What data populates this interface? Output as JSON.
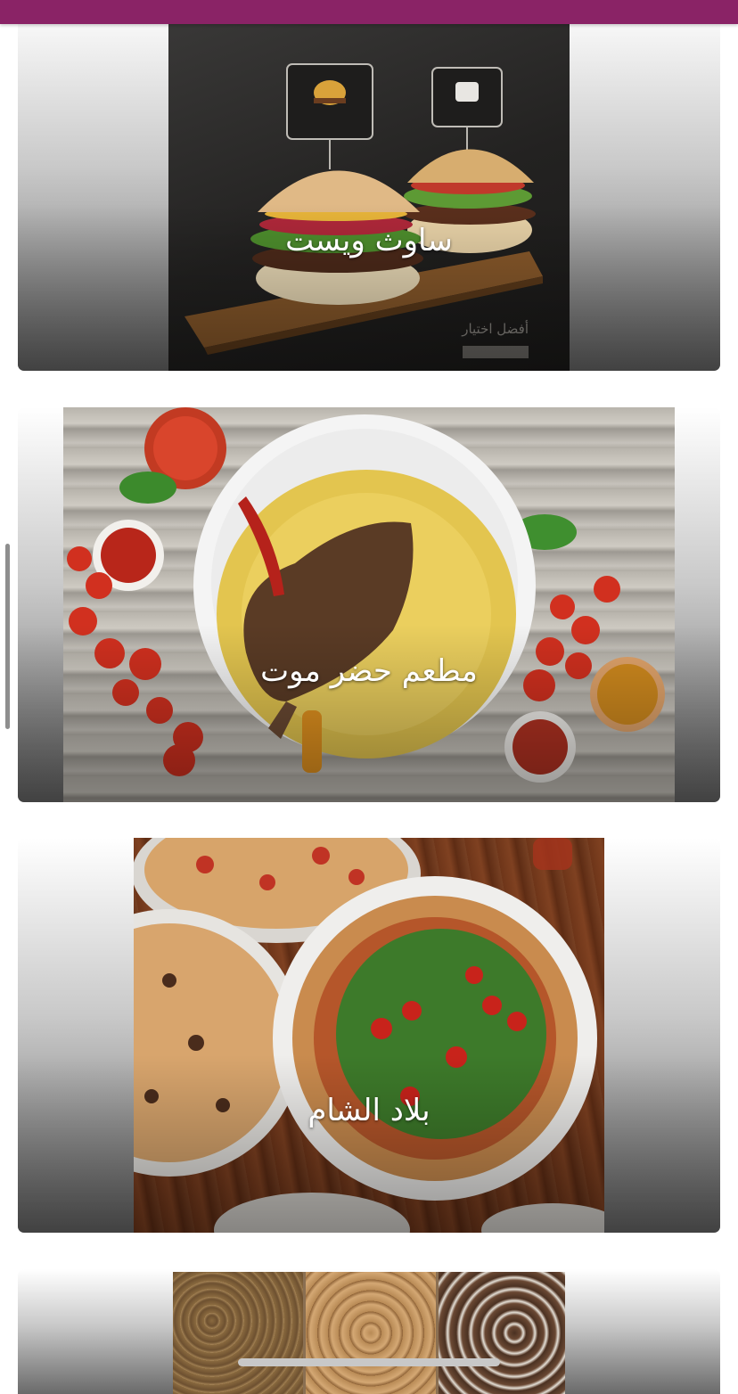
{
  "restaurants": [
    {
      "name": "ساوث ويست"
    },
    {
      "name": "مطعم حضر موت"
    },
    {
      "name": "بلاد الشام"
    },
    {
      "name": ""
    }
  ],
  "photo_caption": "أفضل اختيار",
  "colors": {
    "status_bar": "#8a2366",
    "title_text": "#ffffff"
  }
}
